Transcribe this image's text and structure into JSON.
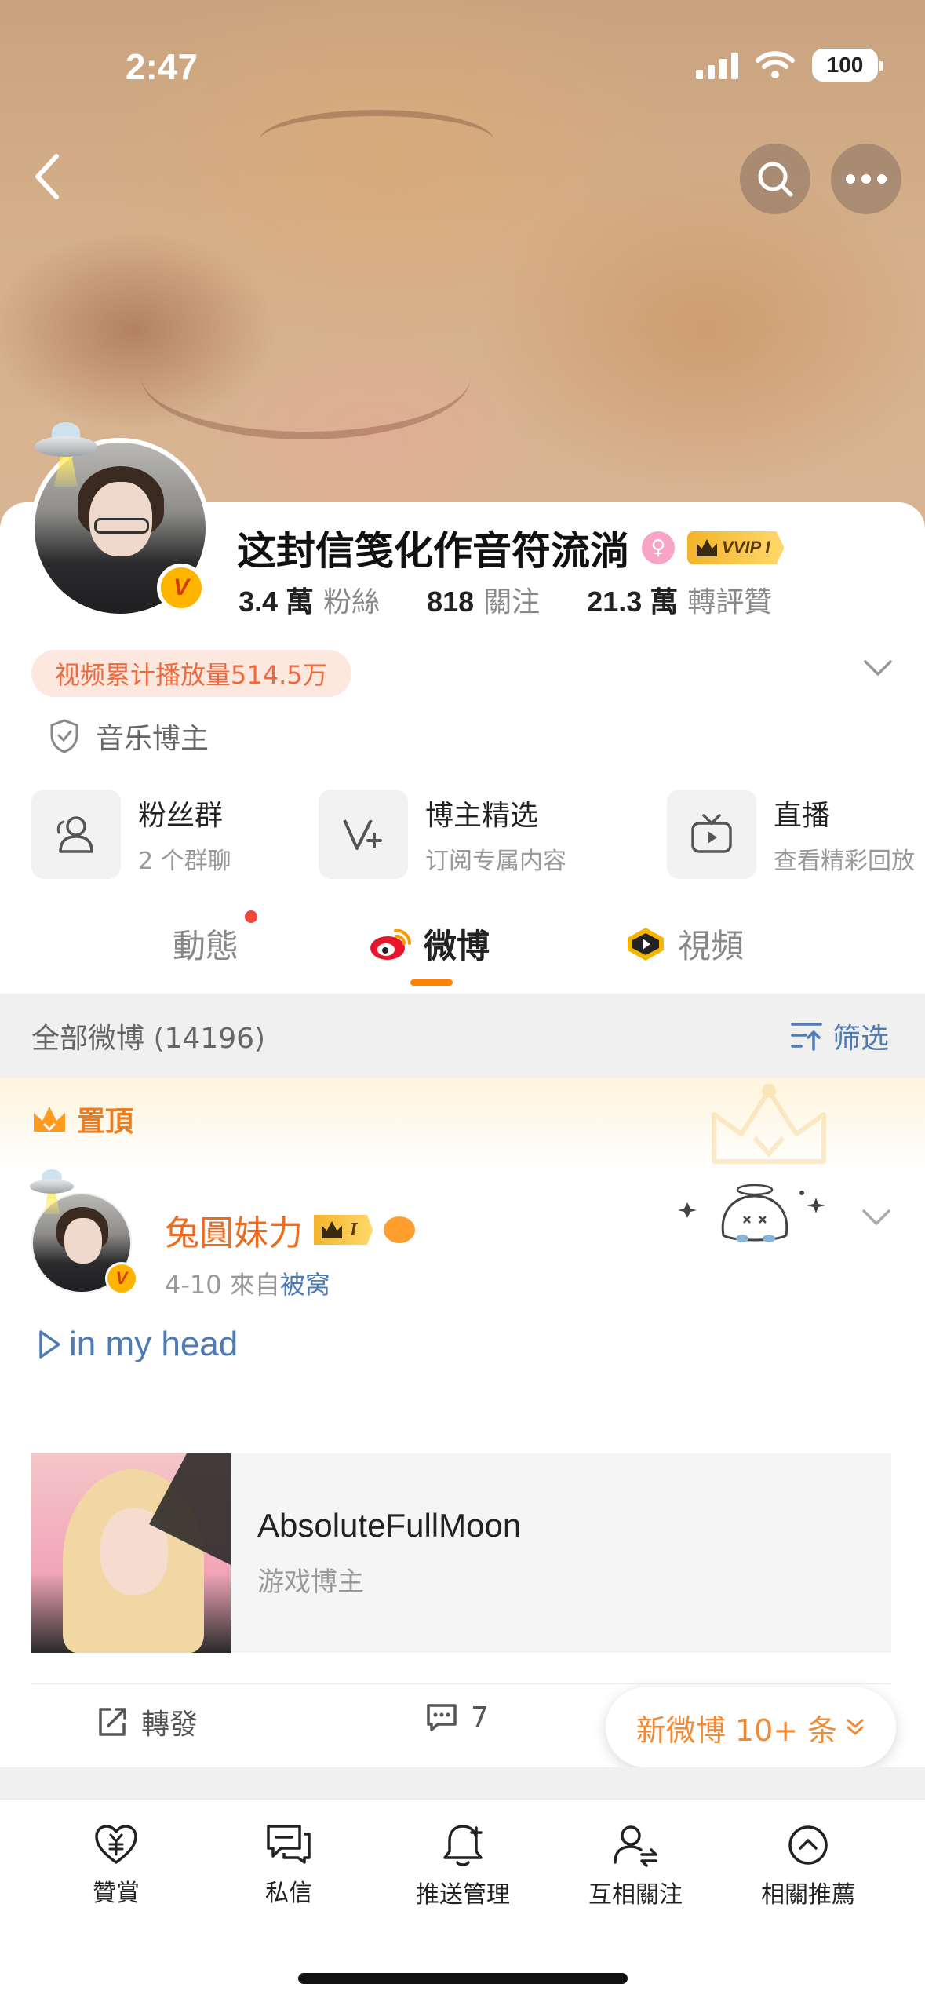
{
  "status_bar": {
    "time": "2:47",
    "battery": "100"
  },
  "profile": {
    "name": "这封信笺化作音符流淌",
    "vip_label": "VVIP I",
    "stats": [
      {
        "num": "3.4 萬",
        "label": "粉絲"
      },
      {
        "num": "818",
        "label": "關注"
      },
      {
        "num": "21.3 萬",
        "label": "轉評贊"
      }
    ],
    "play_count": "视频累计播放量514.5万",
    "role": "音乐博主"
  },
  "functions": [
    {
      "title": "粉丝群",
      "sub": "2 个群聊",
      "icon": "group-icon"
    },
    {
      "title": "博主精选",
      "sub": "订阅专属内容",
      "icon": "v-plus-icon"
    },
    {
      "title": "直播",
      "sub": "查看精彩回放",
      "icon": "tv-icon"
    }
  ],
  "tabs": [
    {
      "label": "動態"
    },
    {
      "label": "微博"
    },
    {
      "label": "視頻"
    }
  ],
  "filter": {
    "count": "全部微博 (14196)",
    "button": "筛选"
  },
  "pinned": {
    "label": "置頂",
    "author": "兔圓妹力",
    "level_badge": "I",
    "meta_prefix": "4-10  來自",
    "meta_source": "被窝",
    "text": "in my head",
    "media": {
      "title": "AbsoluteFullMoon",
      "sub": "游戏博主"
    }
  },
  "actions": {
    "repost": "轉發",
    "comments": "7"
  },
  "new_posts": "新微博 10+ 条",
  "bottom_bar": [
    {
      "label": "贊賞",
      "icon": "reward-heart-icon"
    },
    {
      "label": "私信",
      "icon": "message-icon"
    },
    {
      "label": "推送管理",
      "icon": "bell-icon"
    },
    {
      "label": "互相關注",
      "icon": "mutual-follow-icon"
    },
    {
      "label": "相關推薦",
      "icon": "up-circle-icon"
    }
  ],
  "colors": {
    "accent": "#ff8200",
    "link": "#4d7bb5",
    "author": "#ee6a1e"
  }
}
